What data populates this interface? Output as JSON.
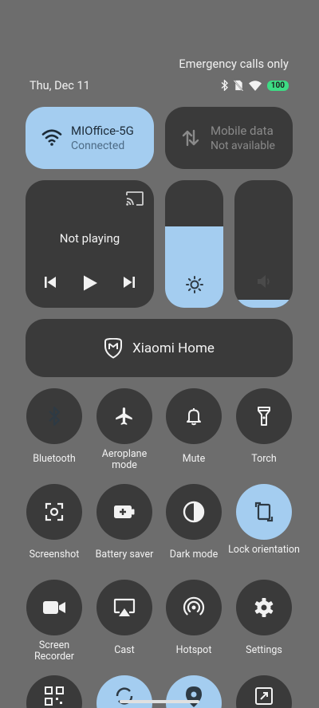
{
  "status": {
    "emergency": "Emergency calls only",
    "date": "Thu, Dec 11",
    "battery": "100"
  },
  "wifi_tile": {
    "title": "MIOffice-5G",
    "subtitle": "Connected"
  },
  "mobile_tile": {
    "title": "Mobile data",
    "subtitle": "Not available"
  },
  "media": {
    "status": "Not playing"
  },
  "brightness": {
    "level": 0.64
  },
  "volume": {
    "level": 0.06
  },
  "xiaomi_home": {
    "label": "Xiaomi Home"
  },
  "toggles": [
    {
      "label": "Bluetooth",
      "active": true
    },
    {
      "label": "Aeroplane mode",
      "active": false
    },
    {
      "label": "Mute",
      "active": false
    },
    {
      "label": "Torch",
      "active": false
    },
    {
      "label": "Screenshot",
      "active": false
    },
    {
      "label": "Battery saver",
      "active": false
    },
    {
      "label": "Dark mode",
      "active": false
    },
    {
      "label": "Lock orientation",
      "active": true
    },
    {
      "label": "Screen Recorder",
      "active": false
    },
    {
      "label": "Cast",
      "active": false
    },
    {
      "label": "Hotspot",
      "active": false
    },
    {
      "label": "Settings",
      "active": false
    }
  ],
  "colors": {
    "accent": "#a4cdf0",
    "tile": "#3a3a3a",
    "background": "#6d6d6d"
  }
}
